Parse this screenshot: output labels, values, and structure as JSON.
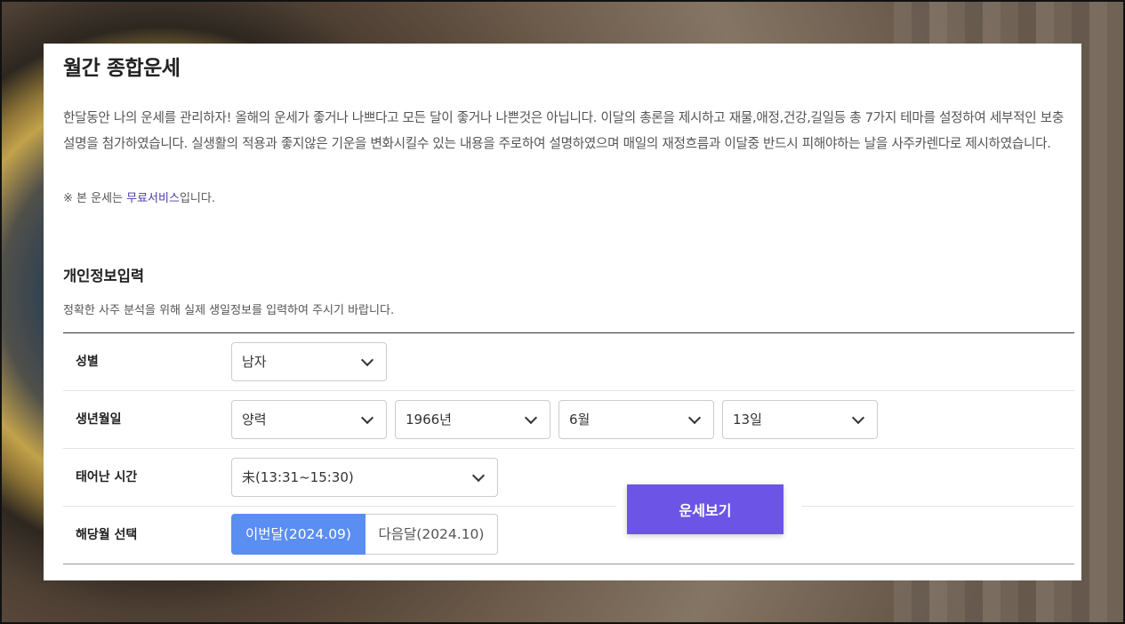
{
  "header": {
    "title": "월간 종합운세"
  },
  "intro": {
    "description": "한달동안 나의 운세를 관리하자! 올해의 운세가 좋거나 나쁘다고 모든 달이 좋거나 나쁜것은 아닙니다. 이달의 총론을 제시하고 재물,애정,건강,길일등 총 7가지 테마를 설정하여 세부적인 보충 설명을 첨가하였습니다. 실생활의 적용과 좋지않은 기운을 변화시킬수 있는 내용을 주로하여 설명하였으며 매일의 재정흐름과 이달중 반드시 피해야하는 날을 사주카렌다로 제시하였습니다.",
    "note_prefix": "※ 본 운세는 ",
    "note_highlight": "무료서비스",
    "note_suffix": "입니다."
  },
  "form": {
    "title": "개인정보입력",
    "subtitle": "정확한 사주 분석을 위해 실제 생일정보를 입력하여 주시기 바랍니다.",
    "gender": {
      "label": "성별",
      "value": "남자"
    },
    "birth": {
      "label": "생년월일",
      "calendar": "양력",
      "year": "1966년",
      "month": "6월",
      "day": "13일"
    },
    "time": {
      "label": "태어난 시간",
      "value": "未(13:31~15:30)"
    },
    "target_month": {
      "label": "해당월 선택",
      "current": "이번달(2024.09)",
      "next": "다음달(2024.10)",
      "selected": "current"
    },
    "submit_label": "운세보기"
  },
  "colors": {
    "accent": "#6c55e6",
    "selected_month": "#5b8ef3",
    "highlight_text": "#4a3aa8"
  }
}
